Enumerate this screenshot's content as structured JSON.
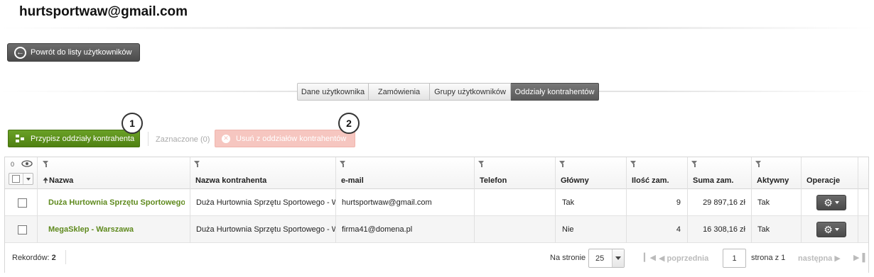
{
  "page": {
    "title": "hurtsportwaw@gmail.com"
  },
  "back_button": {
    "label": "Powrót do listy użytkowników"
  },
  "tabs": [
    {
      "label": "Dane użytkownika",
      "active": false
    },
    {
      "label": "Zamówienia",
      "active": false
    },
    {
      "label": "Grupy użytkowników",
      "active": false
    },
    {
      "label": "Oddziały kontrahentów",
      "active": true
    }
  ],
  "toolbar": {
    "assign_label": "Przypisz oddziały kontrahenta",
    "selected_label": "Zaznaczone (0)",
    "remove_label": "Usuń z oddziałów kontrahentów"
  },
  "callouts": [
    "1",
    "2"
  ],
  "grid": {
    "visibility_count": "0",
    "columns": [
      "Nazwa",
      "Nazwa kontrahenta",
      "e-mail",
      "Telefon",
      "Główny",
      "Ilość zam.",
      "Suma zam.",
      "Aktywny",
      "Operacje"
    ],
    "rows": [
      {
        "name": "Duża Hurtownia Sprzętu Sportowego",
        "contractor": "Duża Hurtownia Sprzętu Sportowego - Warszawa",
        "email": "hurtsportwaw@gmail.com",
        "phone": "",
        "main": "Tak",
        "orders": "9",
        "total": "29 897,16  zł",
        "active": "Tak"
      },
      {
        "name": "MegaSklep - Warszawa",
        "contractor": "Duża Hurtownia Sprzętu Sportowego - Warszawa",
        "email": "firma41@domena.pl",
        "phone": "",
        "main": "Nie",
        "orders": "4",
        "total": "16 308,16  zł",
        "active": "Tak"
      }
    ]
  },
  "footer": {
    "records_label": "Rekordów:",
    "records_count": "2",
    "per_page_label": "Na stronie",
    "per_page_value": "25",
    "prev_label": "poprzednia",
    "page_value": "1",
    "page_of": "strona z 1",
    "next_label": "następna"
  },
  "colors": {
    "accent_green": "#5a8c1a",
    "danger_disabled": "#f6c6c0",
    "dark_button": "#555555",
    "link_green": "#5f8a1e"
  },
  "icons": [
    "back-arrow-icon",
    "assign-tree-icon",
    "remove-x-icon",
    "filter-icon",
    "eye-icon",
    "sort-up-icon",
    "gear-icon",
    "chevron-down-icon",
    "first-page-icon",
    "prev-page-icon",
    "next-page-icon",
    "last-page-icon"
  ]
}
